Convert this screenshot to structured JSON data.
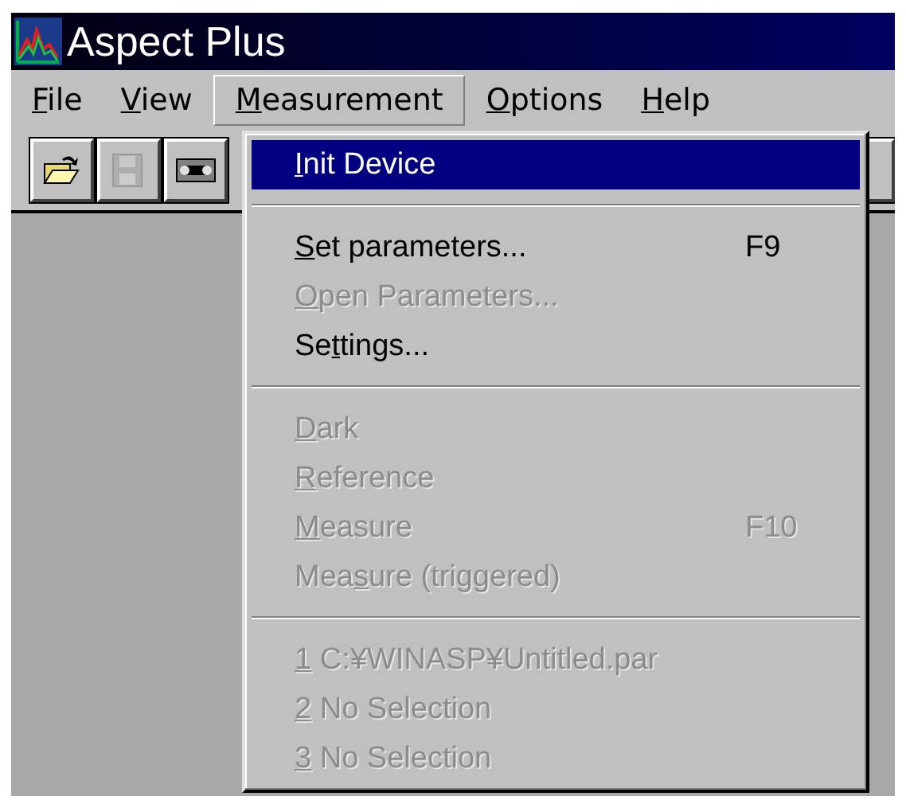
{
  "window": {
    "title": "Aspect Plus"
  },
  "menu_bar": [
    {
      "label": {
        "key": "F",
        "rest": "ile"
      },
      "selected": false
    },
    {
      "label": {
        "key": "V",
        "rest": "iew"
      },
      "selected": false
    },
    {
      "label": {
        "key": "M",
        "rest": "easurement"
      },
      "selected": true
    },
    {
      "label": {
        "key": "O",
        "rest": "ptions"
      },
      "selected": false
    },
    {
      "label": {
        "key": "H",
        "rest": "elp"
      },
      "selected": false
    }
  ],
  "toolbar": [
    {
      "kind": "open",
      "disabled": false
    },
    {
      "kind": "save",
      "disabled": true
    },
    {
      "kind": "tape",
      "disabled": false
    }
  ],
  "dropdown": [
    {
      "kind": "item",
      "label": {
        "key": "I",
        "rest": "nit Device"
      },
      "selected": true,
      "disabled": false
    },
    {
      "kind": "separator"
    },
    {
      "kind": "item",
      "label": {
        "key": "S",
        "rest": "et parameters..."
      },
      "shortcut": "F9",
      "selected": false,
      "disabled": false
    },
    {
      "kind": "item",
      "label": {
        "key": "O",
        "rest": "pen Parameters..."
      },
      "selected": false,
      "disabled": true
    },
    {
      "kind": "item",
      "label": {
        "pre": "Se",
        "key": "t",
        "rest": "tings..."
      },
      "selected": false,
      "disabled": false
    },
    {
      "kind": "separator"
    },
    {
      "kind": "item",
      "label": {
        "key": "D",
        "rest": "ark"
      },
      "selected": false,
      "disabled": true
    },
    {
      "kind": "item",
      "label": {
        "key": "R",
        "rest": "eference"
      },
      "selected": false,
      "disabled": true
    },
    {
      "kind": "item",
      "label": {
        "key": "M",
        "rest": "easure"
      },
      "shortcut": "F10",
      "selected": false,
      "disabled": true
    },
    {
      "kind": "item",
      "label": {
        "pre": "Mea",
        "key": "s",
        "rest": "ure (triggered)"
      },
      "selected": false,
      "disabled": true
    },
    {
      "kind": "separator"
    },
    {
      "kind": "item",
      "label": {
        "key": "1",
        "rest": " C:¥WINASP¥Untitled.par"
      },
      "selected": false,
      "disabled": true
    },
    {
      "kind": "item",
      "label": {
        "key": "2",
        "rest": " No Selection"
      },
      "selected": false,
      "disabled": true
    },
    {
      "kind": "item",
      "label": {
        "key": "3",
        "rest": " No Selection"
      },
      "selected": false,
      "disabled": true
    }
  ]
}
